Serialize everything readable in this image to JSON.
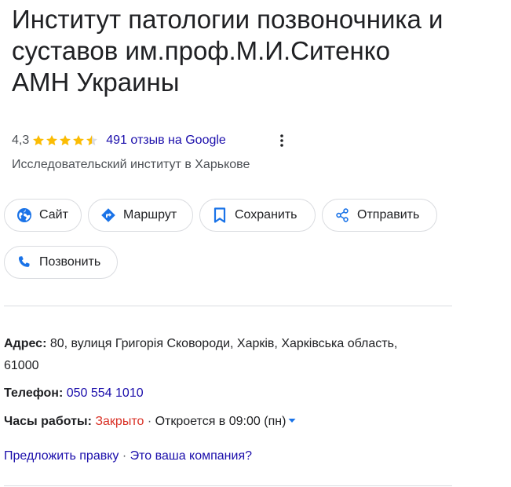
{
  "place": {
    "title": "Институт патологии позвоночника и суставов им.проф.М.И.Ситенко АМН Украины",
    "rating": "4,3",
    "stars_filled_fraction": 0.86,
    "reviews_label": "491 отзыв на Google",
    "category": "Исследовательский институт в Харькове"
  },
  "actions": {
    "website": "Сайт",
    "route": "Маршрут",
    "save": "Сохранить",
    "share": "Отправить",
    "call": "Позвонить"
  },
  "details": {
    "address_label": "Адрес:",
    "address_value": "80, вулиця Григорія Сковороди, Харків, Харківська область, 61000",
    "address_line1": "80, вулиця Григорія Сковороди, Харків, Харківська область,",
    "address_line2": "61000",
    "phone_label": "Телефон:",
    "phone_value": "050 554 1010",
    "hours_label": "Часы работы:",
    "hours_status": "Закрыто",
    "hours_separator": "·",
    "hours_next": "Откроется в 09:00 (пн)"
  },
  "footer_links": {
    "suggest_edit": "Предложить правку",
    "separator": "·",
    "own_business": "Это ваша компания?"
  },
  "colors": {
    "link": "#1a0dab",
    "accent_blue": "#1a73e8",
    "star": "#fbbc04",
    "closed": "#d93025",
    "border": "#dadce0"
  }
}
